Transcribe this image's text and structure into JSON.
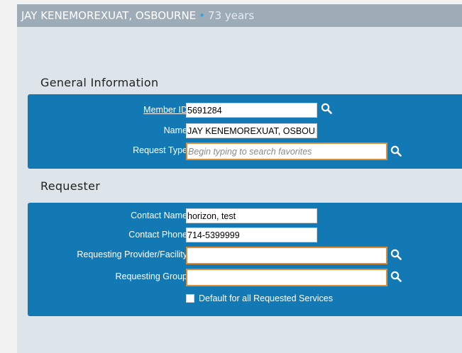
{
  "header": {
    "patient_name": "JAY KENEMOREXUAT, OSBOURNE",
    "separator": "•",
    "age": "73 years"
  },
  "general_information": {
    "title": "General Information",
    "member_id_label": "Member ID",
    "member_id_value": "5691284",
    "name_label": "Name",
    "name_value": "JAY KENEMOREXUAT, OSBOURNE",
    "request_type_label": "Request Type",
    "request_type_placeholder": "Begin typing to search favorites"
  },
  "requester": {
    "title": "Requester",
    "contact_name_label": "Contact Name",
    "contact_name_value": "horizon, test",
    "contact_phone_label": "Contact Phone",
    "contact_phone_value": "714-5399999",
    "requesting_provider_label": "Requesting Provider/Facility",
    "requesting_provider_value": "",
    "requesting_group_label": "Requesting Group",
    "requesting_group_value": "",
    "default_checkbox_label": "Default for all Requested Services",
    "default_checked": false
  },
  "colors": {
    "panel": "#1379b4",
    "header": "#9eacb8",
    "accent_border": "#e28a2f",
    "background": "#dde4ea"
  },
  "icons": [
    "search-icon"
  ]
}
